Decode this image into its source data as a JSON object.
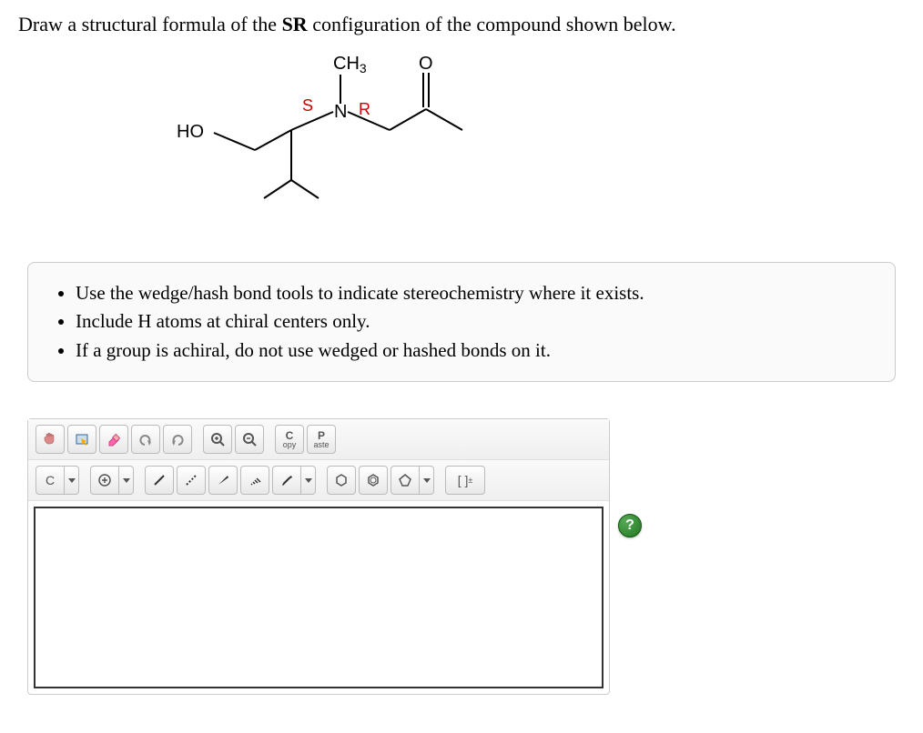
{
  "question": {
    "prefix": "Draw a structural formula of the ",
    "bold": "SR",
    "suffix": " configuration of the compound shown below."
  },
  "molecule_labels": {
    "ch3": "CH",
    "ch3_sub": "3",
    "o": "O",
    "s": "S",
    "n": "N",
    "r": "R",
    "ho": "HO"
  },
  "instructions": [
    "Use the wedge/hash bond tools to indicate stereochemistry where it exists.",
    "Include H atoms at chiral centers only.",
    "If a group is achiral, do not use wedged or hashed bonds on it."
  ],
  "toolbar": {
    "copy_top": "C",
    "copy_bottom": "opy",
    "paste_top": "P",
    "paste_bottom": "aste",
    "atom": "C",
    "charge": "[ ]",
    "charge_sup": "±"
  },
  "help": "?"
}
